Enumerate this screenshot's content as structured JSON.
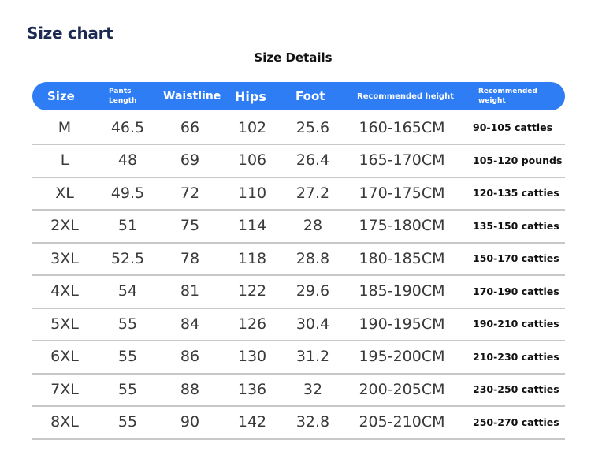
{
  "title": "Size chart",
  "subtitle": "Size Details",
  "header": {
    "size": "Size",
    "pants_length": "Pants Length",
    "waistline": "Waistline",
    "hips": "Hips",
    "foot": "Foot",
    "height": "Recommended height",
    "weight": "Recommended weight"
  },
  "rows": [
    {
      "size": "M",
      "pants": "46.5",
      "waist": "66",
      "hips": "102",
      "foot": "25.6",
      "height": "160-165CM",
      "weight": "90-105 catties"
    },
    {
      "size": "L",
      "pants": "48",
      "waist": "69",
      "hips": "106",
      "foot": "26.4",
      "height": "165-170CM",
      "weight": "105-120 pounds"
    },
    {
      "size": "XL",
      "pants": "49.5",
      "waist": "72",
      "hips": "110",
      "foot": "27.2",
      "height": "170-175CM",
      "weight": "120-135 catties"
    },
    {
      "size": "2XL",
      "pants": "51",
      "waist": "75",
      "hips": "114",
      "foot": "28",
      "height": "175-180CM",
      "weight": "135-150 catties"
    },
    {
      "size": "3XL",
      "pants": "52.5",
      "waist": "78",
      "hips": "118",
      "foot": "28.8",
      "height": "180-185CM",
      "weight": "150-170 catties"
    },
    {
      "size": "4XL",
      "pants": "54",
      "waist": "81",
      "hips": "122",
      "foot": "29.6",
      "height": "185-190CM",
      "weight": "170-190 catties"
    },
    {
      "size": "5XL",
      "pants": "55",
      "waist": "84",
      "hips": "126",
      "foot": "30.4",
      "height": "190-195CM",
      "weight": "190-210 catties"
    },
    {
      "size": "6XL",
      "pants": "55",
      "waist": "86",
      "hips": "130",
      "foot": "31.2",
      "height": "195-200CM",
      "weight": "210-230 catties"
    },
    {
      "size": "7XL",
      "pants": "55",
      "waist": "88",
      "hips": "136",
      "foot": "32",
      "height": "200-205CM",
      "weight": "230-250 catties"
    },
    {
      "size": "8XL",
      "pants": "55",
      "waist": "90",
      "hips": "142",
      "foot": "32.8",
      "height": "205-210CM",
      "weight": "250-270 catties"
    }
  ],
  "colors": {
    "header_bg": "#2e7df5",
    "title": "#1d2a52"
  }
}
